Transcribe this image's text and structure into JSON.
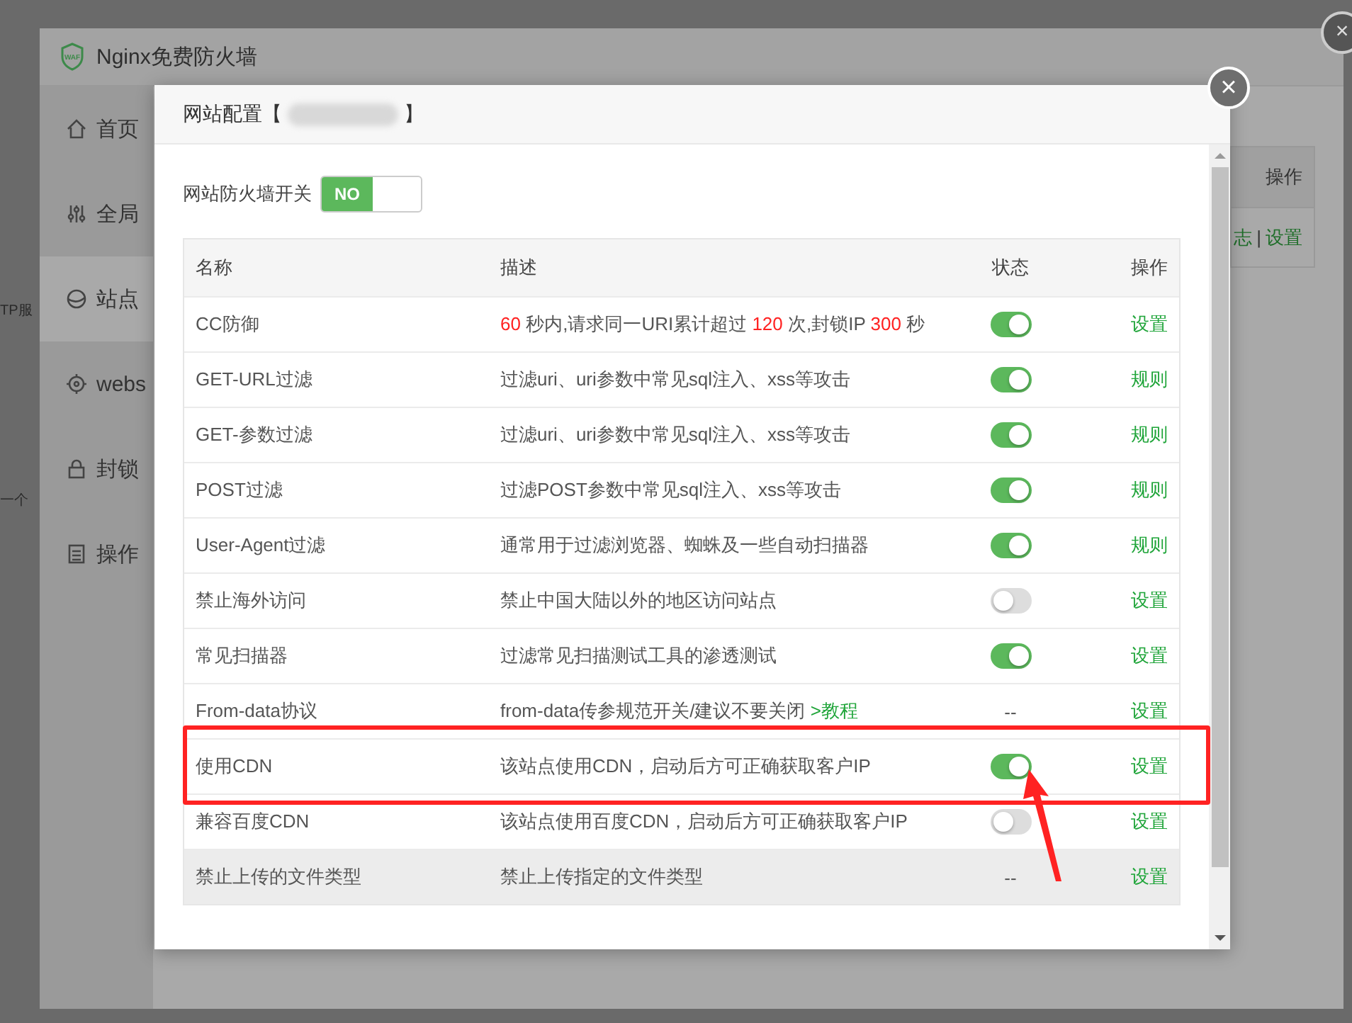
{
  "outside": {
    "fragments": [
      "TP服",
      "一个"
    ]
  },
  "app": {
    "title": "Nginx免费防火墙",
    "logo": "WAF",
    "sidebar": [
      {
        "label": "首页",
        "selected": false
      },
      {
        "label": "全局",
        "selected": false
      },
      {
        "label": "站点",
        "selected": true
      },
      {
        "label": "webs",
        "selected": false
      },
      {
        "label": "封锁",
        "selected": false
      },
      {
        "label": "操作",
        "selected": false
      }
    ],
    "table": {
      "header": "操作",
      "row": [
        "志",
        "|",
        "设置"
      ]
    }
  },
  "dialog": {
    "title_prefix": "网站配置【",
    "title_suffix": "】",
    "close": "×",
    "master_switch": {
      "label": "网站防火墙开关",
      "text": "NO",
      "on": true
    },
    "columns": [
      "名称",
      "描述",
      "状态",
      "操作"
    ],
    "rows": [
      {
        "name": "CC防御",
        "description": [
          {
            "kind": "number",
            "text": "60"
          },
          {
            "kind": "text",
            "text": " 秒内,请求同一URI累计超过 "
          },
          {
            "kind": "number",
            "text": "120"
          },
          {
            "kind": "text",
            "text": " 次,封锁IP "
          },
          {
            "kind": "number",
            "text": "300"
          },
          {
            "kind": "text",
            "text": " 秒"
          }
        ],
        "status": {
          "kind": "toggle",
          "on": true
        },
        "action": "设置",
        "hovered": false
      },
      {
        "name": "GET-URL过滤",
        "description": [
          {
            "kind": "text",
            "text": "过滤uri、uri参数中常见sql注入、xss等攻击"
          }
        ],
        "status": {
          "kind": "toggle",
          "on": true
        },
        "action": "规则",
        "hovered": false
      },
      {
        "name": "GET-参数过滤",
        "description": [
          {
            "kind": "text",
            "text": "过滤uri、uri参数中常见sql注入、xss等攻击"
          }
        ],
        "status": {
          "kind": "toggle",
          "on": true
        },
        "action": "规则",
        "hovered": false
      },
      {
        "name": "POST过滤",
        "description": [
          {
            "kind": "text",
            "text": "过滤POST参数中常见sql注入、xss等攻击"
          }
        ],
        "status": {
          "kind": "toggle",
          "on": true
        },
        "action": "规则",
        "hovered": false
      },
      {
        "name": "User-Agent过滤",
        "description": [
          {
            "kind": "text",
            "text": "通常用于过滤浏览器、蜘蛛及一些自动扫描器"
          }
        ],
        "status": {
          "kind": "toggle",
          "on": true
        },
        "action": "规则",
        "hovered": false
      },
      {
        "name": "禁止海外访问",
        "description": [
          {
            "kind": "text",
            "text": "禁止中国大陆以外的地区访问站点"
          }
        ],
        "status": {
          "kind": "toggle",
          "on": false
        },
        "action": "设置",
        "hovered": false
      },
      {
        "name": "常见扫描器",
        "description": [
          {
            "kind": "text",
            "text": "过滤常见扫描测试工具的渗透测试"
          }
        ],
        "status": {
          "kind": "toggle",
          "on": true
        },
        "action": "设置",
        "hovered": false
      },
      {
        "name": "From-data协议",
        "description": [
          {
            "kind": "text",
            "text": "from-data传参规范开关/建议不要关闭 "
          },
          {
            "kind": "link",
            "text": ">教程"
          }
        ],
        "status": {
          "kind": "text",
          "text": "--"
        },
        "action": "设置",
        "hovered": false
      },
      {
        "name": "使用CDN",
        "description": [
          {
            "kind": "text",
            "text": "该站点使用CDN，启动后方可正确获取客户IP"
          }
        ],
        "status": {
          "kind": "toggle",
          "on": true
        },
        "action": "设置",
        "hovered": false,
        "annotated": true
      },
      {
        "name": "兼容百度CDN",
        "description": [
          {
            "kind": "text",
            "text": "该站点使用百度CDN，启动后方可正确获取客户IP"
          }
        ],
        "status": {
          "kind": "toggle",
          "on": false
        },
        "action": "设置",
        "hovered": false
      },
      {
        "name": "禁止上传的文件类型",
        "description": [
          {
            "kind": "text",
            "text": "禁止上传指定的文件类型"
          }
        ],
        "status": {
          "kind": "text",
          "text": "--"
        },
        "action": "设置",
        "hovered": true
      }
    ]
  }
}
